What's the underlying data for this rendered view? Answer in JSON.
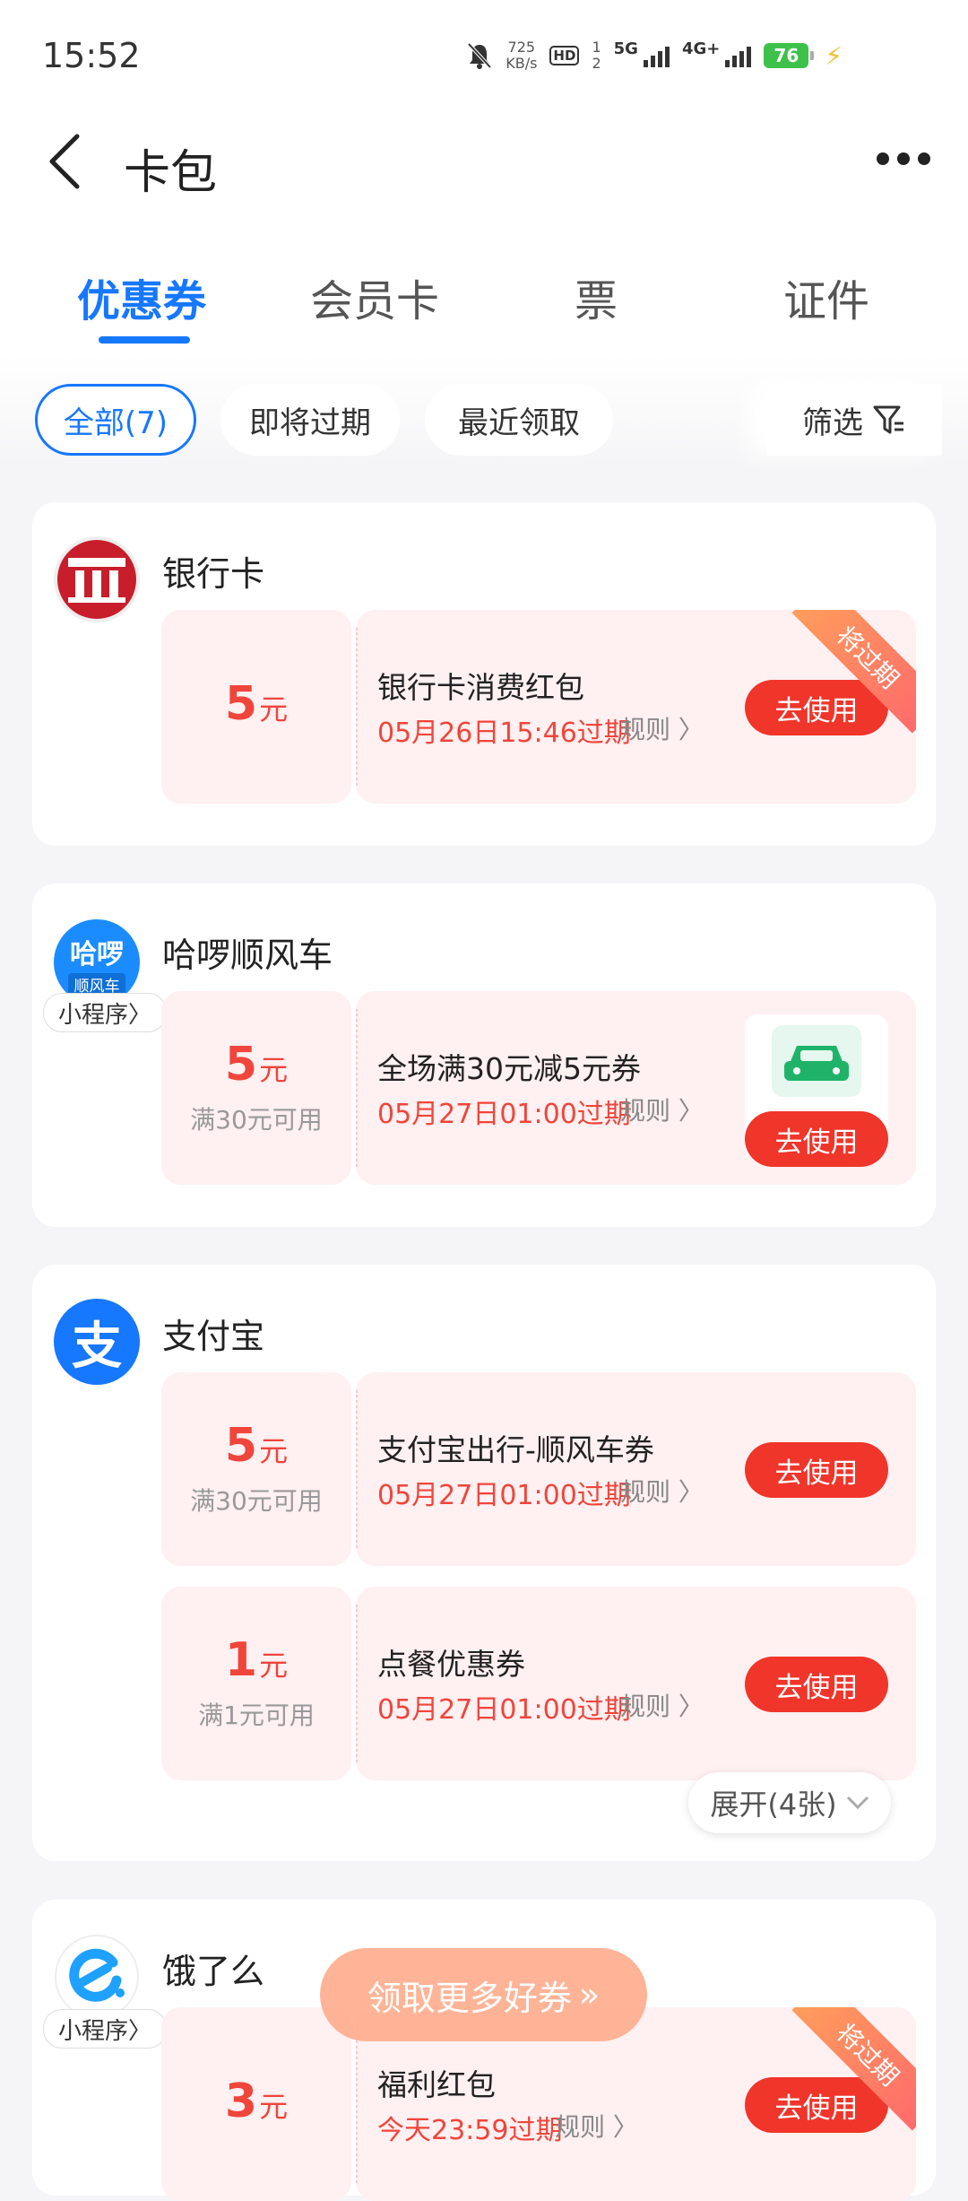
{
  "status_bar": {
    "time": "15:52",
    "net_speed_value": "725",
    "net_speed_unit": "KB/s",
    "hd_label": "HD",
    "sim1": "1",
    "sim2": "2",
    "net1": "5G",
    "net2": "4G+",
    "battery": "76"
  },
  "header": {
    "title": "卡包",
    "back_icon": "chevron-left-icon",
    "more_icon": "more-dots-icon"
  },
  "tabs": [
    {
      "label": "优惠券",
      "active": true
    },
    {
      "label": "会员卡",
      "active": false
    },
    {
      "label": "票",
      "active": false
    },
    {
      "label": "证件",
      "active": false
    }
  ],
  "filters": {
    "chips": [
      {
        "label": "全部(7)",
        "active": true
      },
      {
        "label": "即将过期",
        "active": false
      },
      {
        "label": "最近领取",
        "active": false
      }
    ],
    "filter_label": "筛选"
  },
  "mini_program_label": "小程序",
  "merchants": [
    {
      "name": "银行卡",
      "logo_icon": "bank-icon",
      "coupons": [
        {
          "amount": "5",
          "unit": "元",
          "condition": "",
          "title": "银行卡消费红包",
          "expire": "05月26日15:46过期",
          "rule": "规则",
          "button": "去使用",
          "ribbon": "将过期"
        }
      ]
    },
    {
      "name": "哈啰顺风车",
      "logo_icon": "hello-logo-icon",
      "logo_text_top": "哈啰",
      "logo_text_bottom": "顺风车",
      "coupons": [
        {
          "amount": "5",
          "unit": "元",
          "condition": "满30元可用",
          "title": "全场满30元减5元券",
          "expire": "05月27日01:00过期",
          "rule": "规则",
          "button": "去使用",
          "thumb_icon": "car-icon"
        }
      ]
    },
    {
      "name": "支付宝",
      "logo_icon": "alipay-icon",
      "logo_text": "支",
      "coupons": [
        {
          "amount": "5",
          "unit": "元",
          "condition": "满30元可用",
          "title": "支付宝出行-顺风车券",
          "expire": "05月27日01:00过期",
          "rule": "规则",
          "button": "去使用"
        },
        {
          "amount": "1",
          "unit": "元",
          "condition": "满1元可用",
          "title": "点餐优惠券",
          "expire": "05月27日01:00过期",
          "rule": "规则",
          "button": "去使用"
        }
      ],
      "expand_label": "展开(4张)"
    },
    {
      "name": "饿了么",
      "logo_icon": "eleme-icon",
      "coupons": [
        {
          "amount": "3",
          "unit": "元",
          "condition": "",
          "title": "福利红包",
          "expire": "今天23:59过期",
          "rule": "规则",
          "button": "去使用",
          "ribbon": "将过期"
        }
      ]
    }
  ],
  "floating_button": {
    "label": "领取更多好券",
    "icon": "double-chevron-right-icon"
  },
  "colors": {
    "accent": "#1677ff",
    "red": "#f0352b",
    "coupon_bg": "#fff0f1"
  }
}
